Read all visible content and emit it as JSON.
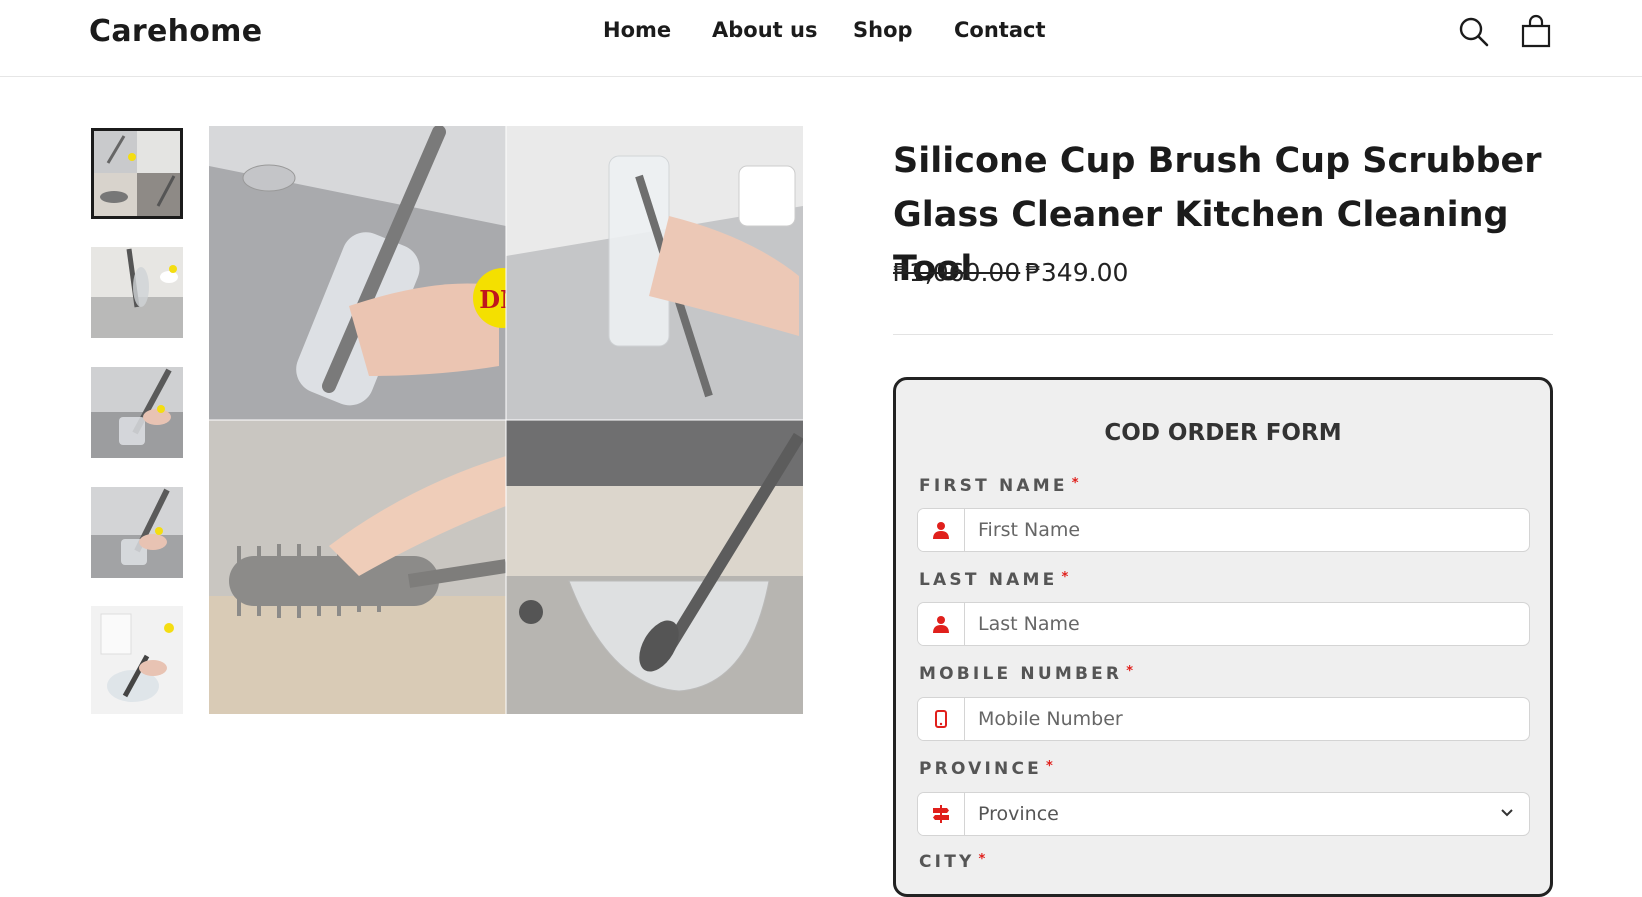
{
  "header": {
    "logo": "Carehome",
    "nav": [
      "Home",
      "About us",
      "Shop",
      "Contact"
    ]
  },
  "icons": {
    "search": "search-icon",
    "cart": "cart-icon",
    "user": "user-icon",
    "phone": "phone-icon",
    "signpost": "signpost-icon",
    "chevron": "chevron-down-icon"
  },
  "colors": {
    "required": "#e0201c",
    "text": "#1b1b1b",
    "form_bg": "#efefef"
  },
  "product": {
    "title": "Silicone Cup Brush Cup Scrubber Glass Cleaner Kitchen Cleaning Tool",
    "price_old": "₱1,060.00",
    "price_new": "₱349.00",
    "brand_badge": "DM"
  },
  "form": {
    "title": "COD ORDER FORM",
    "required_mark": "*",
    "fields": [
      {
        "label": "FIRST NAME",
        "placeholder": "First Name"
      },
      {
        "label": "LAST NAME",
        "placeholder": "Last Name"
      },
      {
        "label": "MOBILE NUMBER",
        "placeholder": "Mobile Number"
      },
      {
        "label": "PROVINCE",
        "value": "Province"
      },
      {
        "label": "CITY"
      }
    ]
  }
}
